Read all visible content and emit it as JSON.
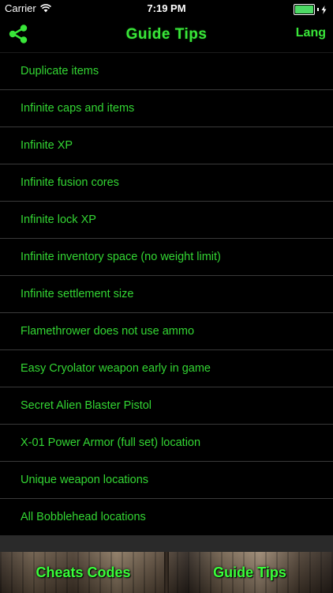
{
  "status_bar": {
    "carrier": "Carrier",
    "time": "7:19 PM",
    "battery_level": 1.0
  },
  "nav": {
    "share_icon": "share-icon",
    "title": "Guide Tips",
    "lang_label": "Lang"
  },
  "list": {
    "items": [
      {
        "label": "Duplicate items"
      },
      {
        "label": "Infinite caps and items"
      },
      {
        "label": "Infinite XP"
      },
      {
        "label": "Infinite fusion cores"
      },
      {
        "label": "Infinite lock XP"
      },
      {
        "label": "Infinite inventory space (no weight limit)"
      },
      {
        "label": "Infinite settlement size"
      },
      {
        "label": "Flamethrower does not use ammo"
      },
      {
        "label": "Easy Cryolator weapon early in game"
      },
      {
        "label": "Secret Alien Blaster Pistol"
      },
      {
        "label": "X-01 Power Armor (full set) location"
      },
      {
        "label": "Unique weapon locations"
      },
      {
        "label": "All Bobblehead locations"
      }
    ]
  },
  "tabs": {
    "cheats_label": "Cheats Codes",
    "guide_label": "Guide Tips"
  },
  "colors": {
    "accent_green": "#39e639",
    "background": "#000000",
    "separator": "#3a3a3a"
  }
}
